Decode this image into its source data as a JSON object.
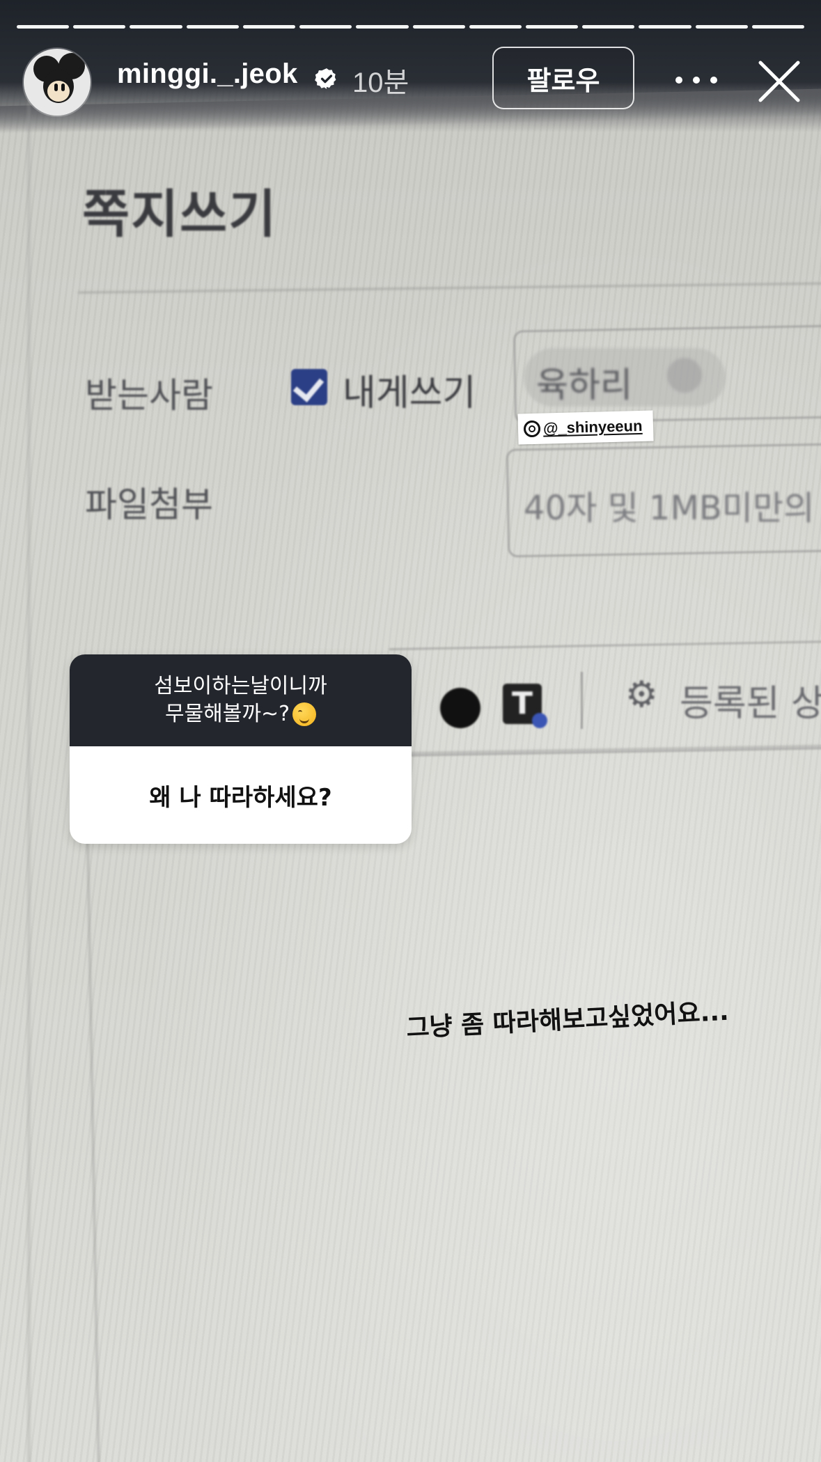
{
  "progress": {
    "segments": 14,
    "completed": 14
  },
  "header": {
    "username": "minggi._.jeok",
    "time_ago": "10분",
    "follow_label": "팔로우"
  },
  "background_screen": {
    "title": "쪽지쓰기",
    "recipient_label": "받는사람",
    "self_write_label": "내게쓰기",
    "recipient_chip": "육하리",
    "attach_label": "파일첨부",
    "attach_hint": "40자 및 1MB미만의",
    "registered_label": "등록된 상",
    "text_style_glyph": "T"
  },
  "mention_sticker": {
    "handle": "@_shinyeeun"
  },
  "question_sticker": {
    "prompt_line1": "섬보이하는날이니까",
    "prompt_line2": "무물해볼까~?",
    "question": "왜 나 따라하세요?"
  },
  "caption": "그냥 좀 따라해보고싶었어요...",
  "colors": {
    "sticker_header_bg": "#24262d",
    "checkbox_blue": "#2b3f86"
  }
}
